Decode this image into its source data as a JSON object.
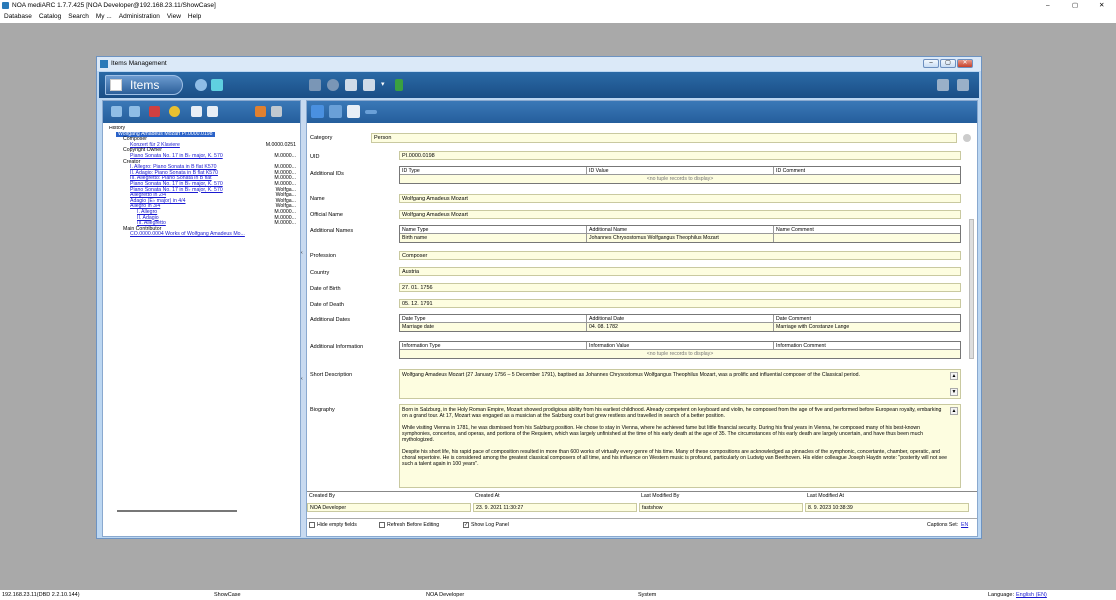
{
  "app": {
    "title": "NOA mediARC 1.7.7.425 [NOA Developer@192.168.23.11/ShowCase]",
    "window_controls": [
      "–",
      "▢",
      "✕"
    ],
    "menu": [
      "Database",
      "Catalog",
      "Search",
      "My ...",
      "Administration",
      "View",
      "Help"
    ]
  },
  "window": {
    "title": "Items Management",
    "items_button": "Items"
  },
  "tree": {
    "lines": [
      {
        "indent": 0,
        "text": "History",
        "code": "",
        "link": false,
        "selected": false
      },
      {
        "indent": 1,
        "text": "Wolfgang Amadeus Mozart   PI.0000.0198",
        "code": "",
        "link": false,
        "selected": true
      },
      {
        "indent": 2,
        "text": "Composer",
        "code": "",
        "link": false,
        "selected": false
      },
      {
        "indent": 3,
        "text": "Konzert für 2 Klaviere",
        "code": "M.0000.0251",
        "link": true,
        "selected": false
      },
      {
        "indent": 2,
        "text": "Copyright Owner",
        "code": "",
        "link": false,
        "selected": false
      },
      {
        "indent": 3,
        "text": "Piano Sonata No. 17 in B♭ major, K. 570",
        "code": "M.0000...",
        "link": true,
        "selected": false
      },
      {
        "indent": 2,
        "text": "Creator",
        "code": "",
        "link": false,
        "selected": false
      },
      {
        "indent": 3,
        "text": "I. Allegro: Piano Sonata in B flat K570",
        "code": "M.0000...",
        "link": true,
        "selected": false
      },
      {
        "indent": 3,
        "text": "II. Adagio: Piano Sonata in B flat K570",
        "code": "M.0000...",
        "link": true,
        "selected": false
      },
      {
        "indent": 3,
        "text": "III. Allegretto: Piano Sonata in B flat",
        "code": "M.0000...",
        "link": true,
        "selected": false
      },
      {
        "indent": 3,
        "text": "Piano Sonata No. 17 in B♭ major, K. 570",
        "code": "M.0000...",
        "link": true,
        "selected": false
      },
      {
        "indent": 3,
        "text": "Piano Sonata No. 17 in B♭ major, K. 570",
        "code": "Wolfga...",
        "link": true,
        "selected": false
      },
      {
        "indent": 3,
        "text": "Allegretto in 2/4",
        "code": "Wolfga...",
        "link": true,
        "selected": false
      },
      {
        "indent": 3,
        "text": "Adagio (E♭ major) in 4/4",
        "code": "Wolfga...",
        "link": true,
        "selected": false
      },
      {
        "indent": 3,
        "text": "Allegro in 3/4",
        "code": "Wolfga...",
        "link": true,
        "selected": false
      },
      {
        "indent": 4,
        "text": "I. Allegro",
        "code": "M.0000...",
        "link": true,
        "selected": false
      },
      {
        "indent": 4,
        "text": "II. Adagio",
        "code": "M.0000...",
        "link": true,
        "selected": false
      },
      {
        "indent": 4,
        "text": "III. Allegretto",
        "code": "M.0000...",
        "link": true,
        "selected": false
      },
      {
        "indent": 2,
        "text": "Main Contributor",
        "code": "",
        "link": false,
        "selected": false
      },
      {
        "indent": 3,
        "text": "CO.0000.0004   Works of Wolfgang Amadeus Mo...",
        "code": "",
        "link": true,
        "selected": false
      }
    ]
  },
  "form": {
    "category_label": "Category",
    "category_value": "Person",
    "uid_label": "UID",
    "uid_value": "PI.0000.0198",
    "additional_ids_label": "Additional IDs",
    "additional_ids_headers": [
      "ID Type",
      "ID Value",
      "ID Comment"
    ],
    "no_records": "<no tuple records to display>",
    "name_label": "Name",
    "name_value": "Wolfgang Amadeus Mozart",
    "official_name_label": "Official Name",
    "official_name_value": "Wolfgang Amadeus Mozart",
    "additional_names_label": "Additional Names",
    "additional_names_headers": [
      "Name Type",
      "Additional Name",
      "Name Comment"
    ],
    "additional_names_row": [
      "Birth name",
      "Johannes Chrysostomus Wolfgangus Theophilus Mozart",
      ""
    ],
    "profession_label": "Profession",
    "profession_value": "Composer",
    "country_label": "Country",
    "country_value": "Austria",
    "dob_label": "Date of Birth",
    "dob_value": "27. 01. 1756",
    "dod_label": "Date of Death",
    "dod_value": "05. 12. 1791",
    "additional_dates_label": "Additional Dates",
    "additional_dates_headers": [
      "Date Type",
      "Additional Date",
      "Date Comment"
    ],
    "additional_dates_row": [
      "Marriage date",
      "04. 08. 1782",
      "Marriage with Constanze Lange"
    ],
    "additional_info_label": "Additional Information",
    "additional_info_headers": [
      "Information Type",
      "Information Value",
      "Information Comment"
    ],
    "short_desc_label": "Short Description",
    "short_desc_value": "Wolfgang Amadeus Mozart (27 January 1756 – 5 December 1791), baptised as Johannes Chrysostomus Wolfgangus Theophilus Mozart, was a prolific and influential composer of the Classical period.",
    "biography_label": "Biography",
    "biography_p1": "Born in Salzburg, in the Holy Roman Empire, Mozart showed prodigious ability from his earliest childhood. Already competent on keyboard and violin, he composed from the age of five and performed before European royalty, embarking on a grand tour. At 17, Mozart was engaged as a musician at the Salzburg court but grew restless and travelled in search of a better position.",
    "biography_p2": "While visiting Vienna in 1781, he was dismissed from his Salzburg position. He chose to stay in Vienna, where he achieved fame but little financial security. During his final years in Vienna, he composed many of his best-known symphonies, concertos, and operas, and portions of the Requiem, which was largely unfinished at the time of his early death at the age of 35. The circumstances of his early death are largely uncertain, and have thus been much mythologized.",
    "biography_p3": "Despite his short life, his rapid pace of composition resulted in more than 600 works of virtually every genre of his time. Many of these compositions are acknowledged as pinnacles of the symphonic, concertante, chamber, operatic, and choral repertoire. He is considered among the greatest classical composers of all time, and his influence on Western music is profound, particularly on Ludwig van Beethoven. His elder colleague Joseph Haydn wrote: \"posterity will not see such a talent again in 100 years\"."
  },
  "footer": {
    "created_by_label": "Created By",
    "created_by_value": "NOA Developer",
    "created_at_label": "Created At",
    "created_at_value": "23. 9. 2021 11:30:27",
    "modified_by_label": "Last Modified By",
    "modified_by_value": "fastshow",
    "modified_at_label": "Last Modified At",
    "modified_at_value": "8. 9. 2023 10:38:39"
  },
  "bottombar": {
    "hide_empty": "Hide empty fields",
    "refresh": "Refresh Before Editing",
    "show_log": "Show Log Panel",
    "captions_set": "Captions Set:",
    "captions_lang": "EN"
  },
  "status": {
    "server": "192.168.23.11(DBD 2.2.10.144)",
    "database": "ShowCase",
    "user": "NOA Developer",
    "role": "System",
    "language_label": "Language:",
    "language_value": "English (EN)"
  },
  "colors": {
    "toolbar_blue": "#1a4e86",
    "field_yellow": "#fdfde0",
    "selection_blue": "#2a62c8"
  }
}
